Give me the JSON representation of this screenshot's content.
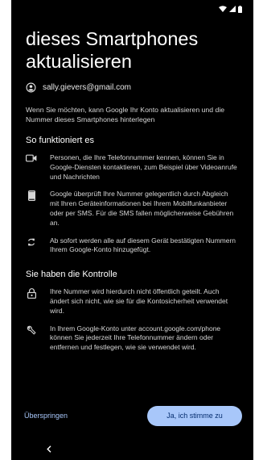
{
  "title": "dieses Smartphones aktualisieren",
  "account": {
    "email": "sally.gievers@gmail.com",
    "icon": "account-circle-icon"
  },
  "intro": "Wenn Sie möchten, kann Google Ihr Konto aktualisieren und die Nummer dieses Smartphones hinterlegen",
  "how_it_works": {
    "heading": "So funktioniert es",
    "items": [
      {
        "icon": "video-camera-icon",
        "text": "Personen, die Ihre Telefonnummer kennen, können Sie in Google-Diensten kontaktieren, zum Beispiel über Videoanrufe und Nachrichten"
      },
      {
        "icon": "phone-device-icon",
        "text": "Google überprüft Ihre Nummer gelegentlich durch Abgleich mit Ihren Geräteinformationen bei Ihrem Mobilfunkanbieter oder per SMS. Für die SMS fallen möglicherweise Gebühren an."
      },
      {
        "icon": "sync-icon",
        "text": "Ab sofort werden alle auf diesem Gerät bestätigten Nummern Ihrem Google-Konto hinzugefügt."
      }
    ]
  },
  "control": {
    "heading": "Sie haben die Kontrolle",
    "items": [
      {
        "icon": "lock-icon",
        "text": "Ihre Nummer wird hierdurch nicht öffentlich geteilt. Auch ändert sich nicht, wie sie für die Kontosicherheit verwendet wird."
      },
      {
        "icon": "wrench-icon",
        "text": "In Ihrem Google-Konto unter account.google.com/phone können Sie jederzeit Ihre Telefonnummer ändern oder entfernen und festlegen, wie sie verwendet wird."
      }
    ]
  },
  "buttons": {
    "skip": "Überspringen",
    "agree": "Ja, ich stimme zu"
  },
  "colors": {
    "background": "#000000",
    "accent": "#a8c7fa",
    "button_text": "#062e6f"
  }
}
